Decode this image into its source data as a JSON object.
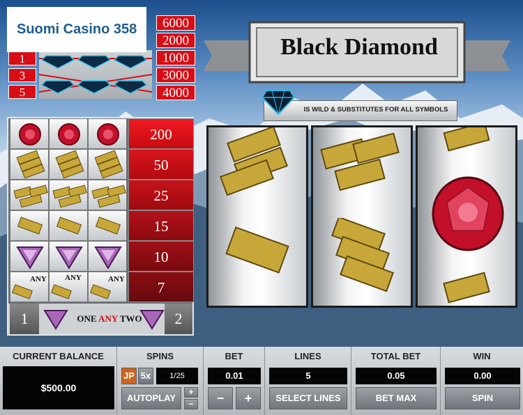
{
  "logo": {
    "text": "Suomi Casino 358"
  },
  "line_payouts": {
    "line_numbers": [
      "1",
      "3",
      "5"
    ],
    "payouts": [
      "6000",
      "2000",
      "1000",
      "3000",
      "4000"
    ]
  },
  "title": "Black Diamond",
  "wild_banner": "IS WILD & SUBSTITUTES FOR ALL SYMBOLS",
  "paytable": {
    "rows": [
      {
        "symbol": "ruby-icon",
        "pay": "200"
      },
      {
        "symbol": "triple-bar-icon",
        "pay": "50"
      },
      {
        "symbol": "double-bar-icon",
        "pay": "25"
      },
      {
        "symbol": "single-bar-icon",
        "pay": "15"
      },
      {
        "symbol": "amethyst-icon",
        "pay": "10"
      },
      {
        "symbol": "any-bar-icon",
        "pay": "7"
      }
    ],
    "any_label": "ANY",
    "one_any_two": {
      "left": "1",
      "one": "ONE",
      "any": "ANY",
      "two": "TWO",
      "right": "2"
    }
  },
  "reels": [
    [
      "triple-bar-icon",
      "single-bar-icon"
    ],
    [
      "double-bar-icon",
      "triple-bar-icon"
    ],
    [
      "double-bar-icon",
      "ruby-icon",
      "double-bar-icon"
    ]
  ],
  "controls": {
    "balance": {
      "title": "CURRENT BALANCE",
      "value": "$500.00"
    },
    "spins": {
      "title": "SPINS",
      "jp": "JP",
      "x5": "5x",
      "counter": "1/25",
      "autoplay": "AUTOPLAY",
      "plus": "+",
      "minus": "−"
    },
    "bet": {
      "title": "BET",
      "value": "0.01",
      "minus": "−",
      "plus": "+"
    },
    "lines": {
      "title": "LINES",
      "value": "5",
      "button": "SELECT LINES"
    },
    "total_bet": {
      "title": "TOTAL BET",
      "value": "0.05",
      "button": "BET MAX"
    },
    "win": {
      "title": "WIN",
      "value": "0.00",
      "button": "SPIN"
    }
  },
  "colors": {
    "red": "#d80d15",
    "dark_red": "#7a0a0f",
    "panel": "#c7cbcf"
  }
}
